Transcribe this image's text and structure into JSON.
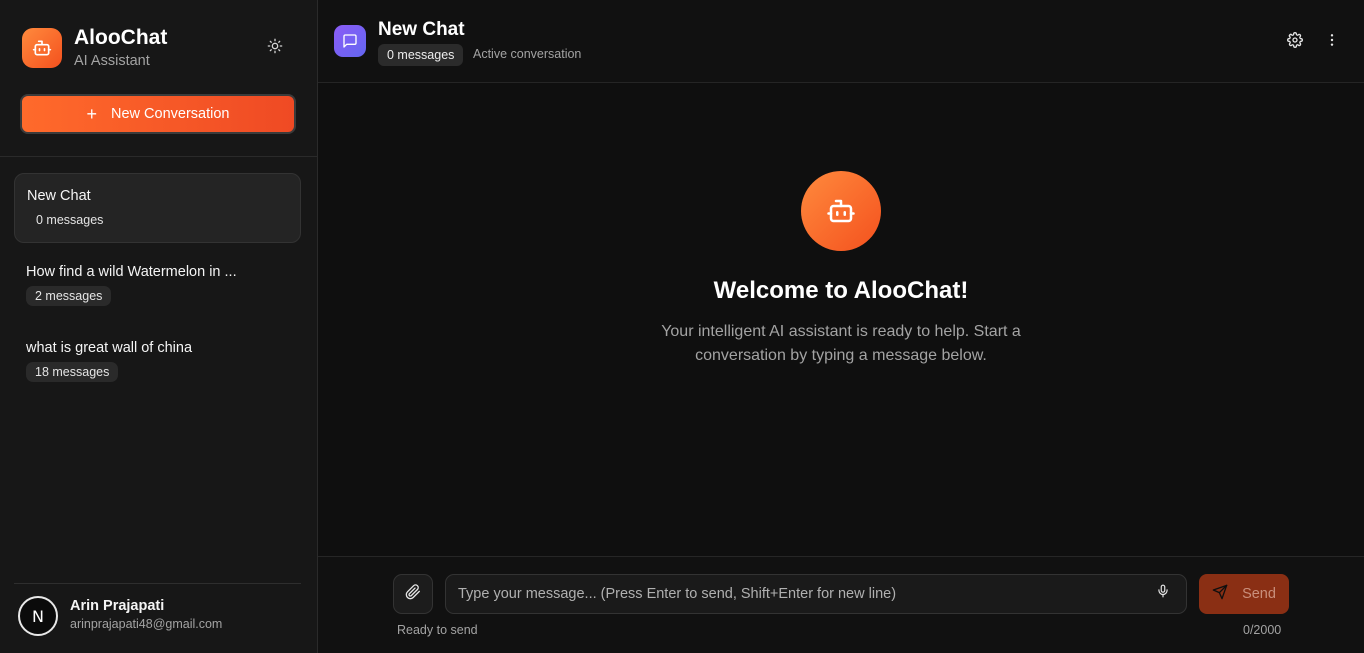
{
  "sidebar": {
    "brand_name": "AlooChat",
    "brand_subtitle": "AI Assistant",
    "new_conversation_label": "New Conversation",
    "conversations": [
      {
        "title": "New Chat",
        "badge": "0 messages",
        "active": true
      },
      {
        "title": "How find a wild Watermelon in ...",
        "badge": "2 messages",
        "active": false
      },
      {
        "title": "what is great wall of china",
        "badge": "18 messages",
        "active": false
      }
    ],
    "user": {
      "initial": "N",
      "name": "Arin Prajapati",
      "email": "arinprajapati48@gmail.com"
    }
  },
  "header": {
    "title": "New Chat",
    "message_count": "0 messages",
    "status": "Active conversation"
  },
  "welcome": {
    "title": "Welcome to AlooChat!",
    "text": "Your intelligent AI assistant is ready to help. Start a conversation by typing a message below."
  },
  "composer": {
    "placeholder": "Type your message... (Press Enter to send, Shift+Enter for new line)",
    "send_label": "Send",
    "status": "Ready to send",
    "char_count": "0/2000"
  },
  "colors": {
    "accent": "#f4511e",
    "accent_light": "#ff8a3d",
    "chat_icon": "#7c5cf0",
    "background": "#111111"
  },
  "icons": {
    "brand": "robot-icon",
    "theme": "sun-icon",
    "chat": "message-square-icon",
    "settings": "gear-icon",
    "more": "more-vertical-icon",
    "attach": "paperclip-icon",
    "mic": "microphone-icon",
    "send": "send-icon"
  }
}
